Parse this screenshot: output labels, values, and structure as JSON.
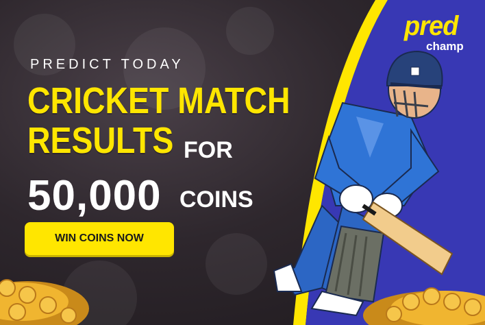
{
  "brand": {
    "logo_main": "pred",
    "logo_sub": "champ",
    "colors": {
      "accent": "#ffe600",
      "panel": "#3636b0",
      "dark": "#2e272d"
    }
  },
  "promo": {
    "eyebrow": "PREDICT TODAY",
    "headline_line1": "CRICKET MATCH",
    "headline_line2": "RESULTS",
    "for_text": "FOR",
    "amount": "50,000",
    "coins_text": "COINS",
    "cta_label": "WIN COINS NOW"
  },
  "illustration": {
    "subject": "cricket batsman",
    "decor": "gold coin piles"
  }
}
